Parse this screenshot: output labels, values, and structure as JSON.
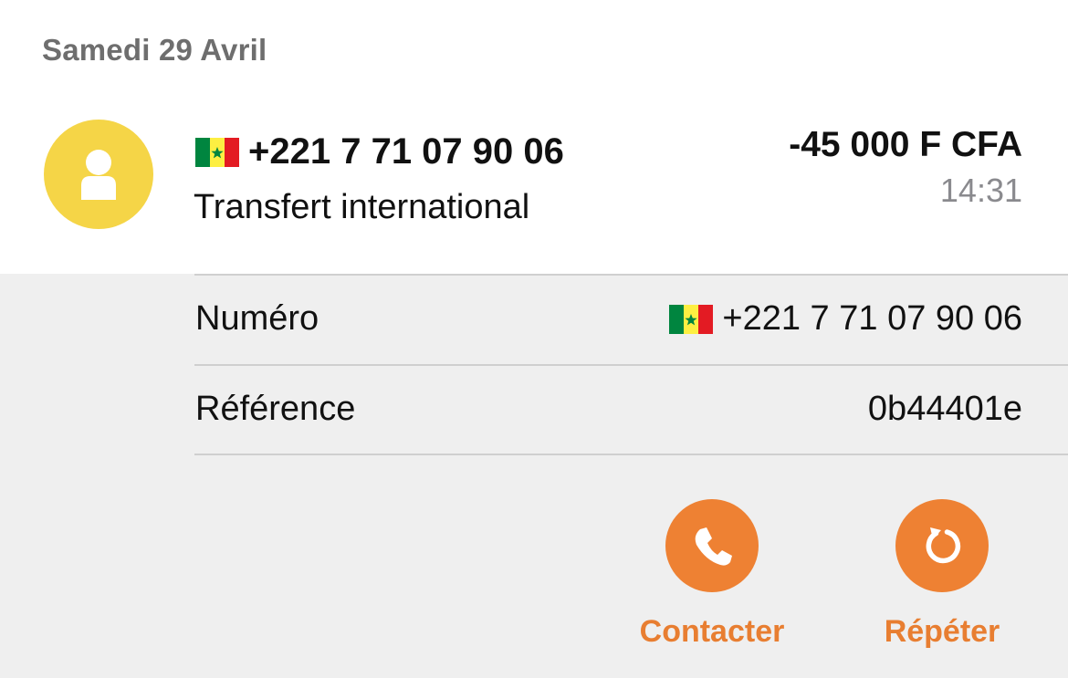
{
  "date_header": "Samedi 29 Avril",
  "transaction": {
    "avatar_icon": "person-icon",
    "avatar_color": "#f5d547",
    "flag_icon": "senegal-flag-icon",
    "phone": "+221 7 71 07 90 06",
    "type": "Transfert international",
    "amount": "-45 000 F CFA",
    "time": "14:31"
  },
  "details": {
    "rows": [
      {
        "label": "Numéro",
        "value": "+221 7 71 07 90 06",
        "icon": "senegal-flag-icon"
      },
      {
        "label": "Référence",
        "value": "0b44401e"
      }
    ]
  },
  "actions": [
    {
      "label": "Contacter",
      "icon": "phone-icon"
    },
    {
      "label": "Répéter",
      "icon": "repeat-icon"
    }
  ],
  "colors": {
    "accent": "#ee8133",
    "avatar": "#f5d547",
    "panel_bg": "#efefef",
    "muted_text": "#6e6e6e"
  }
}
